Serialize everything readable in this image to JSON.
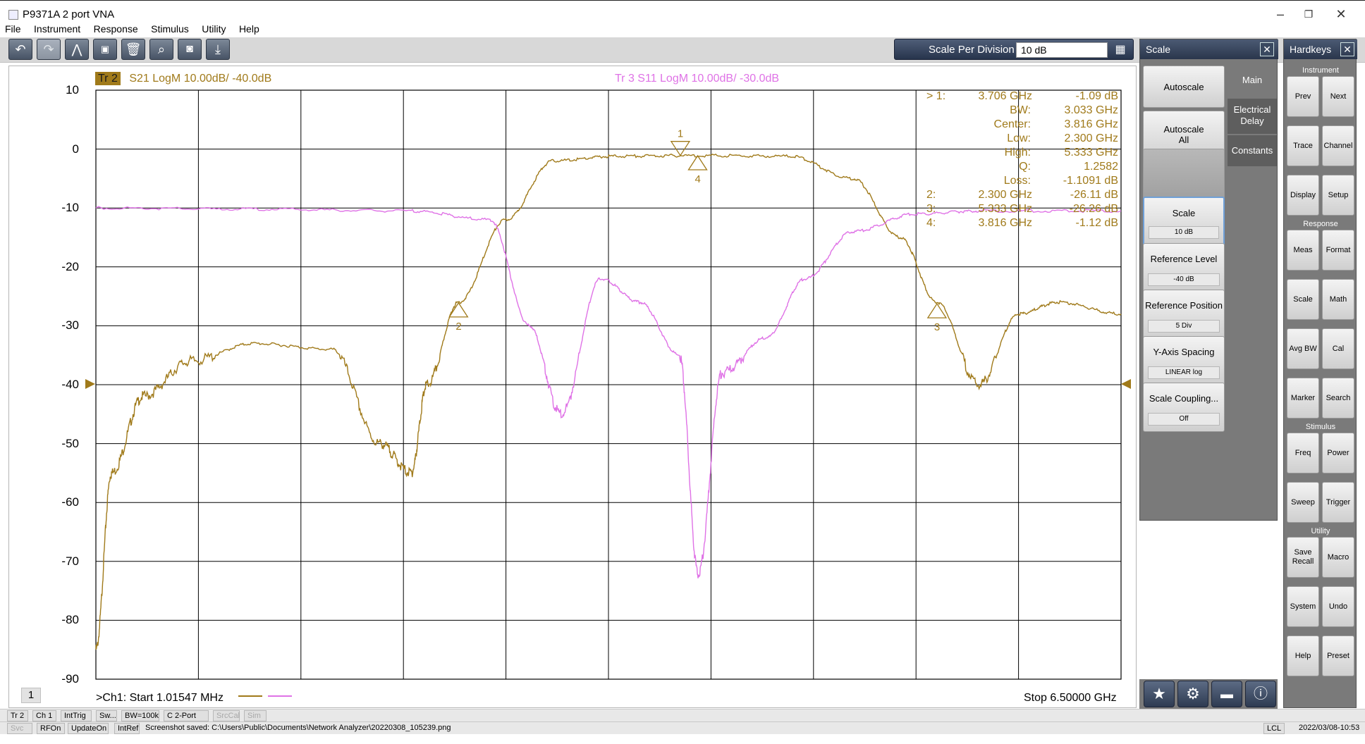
{
  "window": {
    "title": "P9371A 2 port VNA",
    "min": "–",
    "max": "❐",
    "close": "✕"
  },
  "menu": [
    "File",
    "Instrument",
    "Response",
    "Stimulus",
    "Utility",
    "Help"
  ],
  "toolbar_icons": [
    "undo-icon",
    "redo-icon",
    "marker-icon",
    "cal-icon",
    "delete-icon",
    "zoom-icon",
    "camera-icon",
    "save-icon"
  ],
  "scale_per_division": {
    "label": "Scale Per Division",
    "value": "10 dB"
  },
  "trace_headers": {
    "tr2_badge": "Tr 2",
    "tr2_text": "S21 LogM 10.00dB/  -40.0dB",
    "tr3_text": "Tr  3   S11 LogM 10.00dB/  -30.0dB"
  },
  "colors": {
    "tr2": "#a07a1a",
    "tr3": "#df72e6",
    "grid": "#000000"
  },
  "chart_data": {
    "type": "line",
    "xlabel": "",
    "ylabel": "",
    "xlim": [
      0.00101547,
      6.5
    ],
    "ylim": [
      -90,
      10
    ],
    "y_tick_labels": [
      "10",
      "0",
      "-10",
      "-20",
      "-30",
      "-40",
      "-50",
      "-60",
      "-70",
      "-80",
      "-90"
    ],
    "series": [
      {
        "name": "S21",
        "color": "#a07a1a",
        "x": [
          0.001,
          0.1,
          0.3,
          0.6,
          1.0,
          1.5,
          1.8,
          2.0,
          2.1,
          2.3,
          2.6,
          2.9,
          3.3,
          3.8,
          4.4,
          4.8,
          5.1,
          5.333,
          5.6,
          5.85,
          6.1,
          6.5
        ],
        "y": [
          -85,
          -55,
          -42,
          -36,
          -33,
          -34,
          -50,
          -55,
          -40,
          -26,
          -12,
          -2,
          -1.2,
          -1.1,
          -1.2,
          -5,
          -15,
          -26,
          -40,
          -28,
          -26,
          -28
        ]
      },
      {
        "name": "S11",
        "color": "#df72e6",
        "x": [
          0.001,
          1.0,
          2.0,
          2.5,
          2.75,
          2.95,
          3.2,
          3.45,
          3.7,
          3.82,
          3.97,
          4.25,
          4.5,
          4.8,
          5.2,
          5.6,
          6.5
        ],
        "y": [
          -10,
          -10.2,
          -10.5,
          -12,
          -30,
          -45,
          -22,
          -26,
          -35,
          -72,
          -38,
          -32,
          -22,
          -14,
          -11,
          -10.5,
          -10.5
        ]
      }
    ],
    "markers": [
      {
        "id": "1",
        "x": 3.706,
        "y": -1.09
      },
      {
        "id": "2",
        "x": 2.3,
        "y": -26.11
      },
      {
        "id": "3",
        "x": 5.333,
        "y": -26.26
      },
      {
        "id": "4",
        "x": 3.816,
        "y": -1.12
      }
    ]
  },
  "marker_table": [
    {
      "label": "> 1:",
      "value": "3.706  GHz",
      "result": "-1.09 dB"
    },
    {
      "label": "BW:",
      "value": "",
      "result": "3.033 GHz"
    },
    {
      "label": "Center:",
      "value": "",
      "result": "3.816 GHz"
    },
    {
      "label": "Low:",
      "value": "",
      "result": "2.300 GHz"
    },
    {
      "label": "High:",
      "value": "",
      "result": "5.333 GHz"
    },
    {
      "label": "Q:",
      "value": "",
      "result": "1.2582"
    },
    {
      "label": "Loss:",
      "value": "",
      "result": "-1.1091 dB"
    },
    {
      "label": "2:",
      "value": "2.300  GHz",
      "result": "-26.11 dB"
    },
    {
      "label": "3:",
      "value": "5.333  GHz",
      "result": "-26.26 dB"
    },
    {
      "label": "4:",
      "value": "3.816  GHz",
      "result": "-1.12 dB"
    }
  ],
  "plot_bottom": {
    "channel": "1",
    "start": ">Ch1:  Start   1.01547 MHz",
    "stop": "Stop  6.50000 GHz"
  },
  "side_menu": {
    "title": "Scale",
    "buttons": [
      {
        "label": "Autoscale",
        "value": ""
      },
      {
        "label": "Autoscale\nAll",
        "value": ""
      },
      {
        "label": "",
        "value": ""
      },
      {
        "label": "Scale",
        "value": "10 dB"
      },
      {
        "label": "Reference Level",
        "value": "-40 dB"
      },
      {
        "label": "Reference Position",
        "value": "5 Div"
      },
      {
        "label": "Y-Axis Spacing",
        "value": "LINEAR       log"
      },
      {
        "label": "Scale Coupling...",
        "value": "Off"
      }
    ],
    "tabs": [
      "Main",
      "Electrical Delay",
      "Constants"
    ],
    "footer_icons": [
      "star-icon",
      "gear-icon",
      "folder-icon",
      "info-icon"
    ]
  },
  "hardkeys": {
    "title": "Hardkeys",
    "sections": [
      {
        "name": "Instrument",
        "keys": [
          "Prev",
          "Next",
          "Trace",
          "Channel",
          "Display",
          "Setup"
        ]
      },
      {
        "name": "Response",
        "keys": [
          "Meas",
          "Format",
          "Scale",
          "Math",
          "Avg BW",
          "Cal",
          "Marker",
          "Search"
        ]
      },
      {
        "name": "Stimulus",
        "keys": [
          "Freq",
          "Power",
          "Sweep",
          "Trigger"
        ]
      },
      {
        "name": "Utility",
        "keys": [
          "Save Recall",
          "Macro",
          "System",
          "Undo",
          "Help",
          "Preset"
        ]
      }
    ]
  },
  "status1": [
    "Tr 2",
    "Ch 1",
    "IntTrig",
    "Sw...",
    "BW=100k",
    "C  2-Port",
    "SrcCal",
    "Sim"
  ],
  "status2": [
    "Svc",
    "RFOn",
    "UpdateOn",
    "IntRef",
    "Screenshot saved: C:\\Users\\Public\\Documents\\Network Analyzer\\20220308_105239.png"
  ],
  "status_right": {
    "lcl": "LCL",
    "datetime": "2022/03/08-10:53"
  }
}
